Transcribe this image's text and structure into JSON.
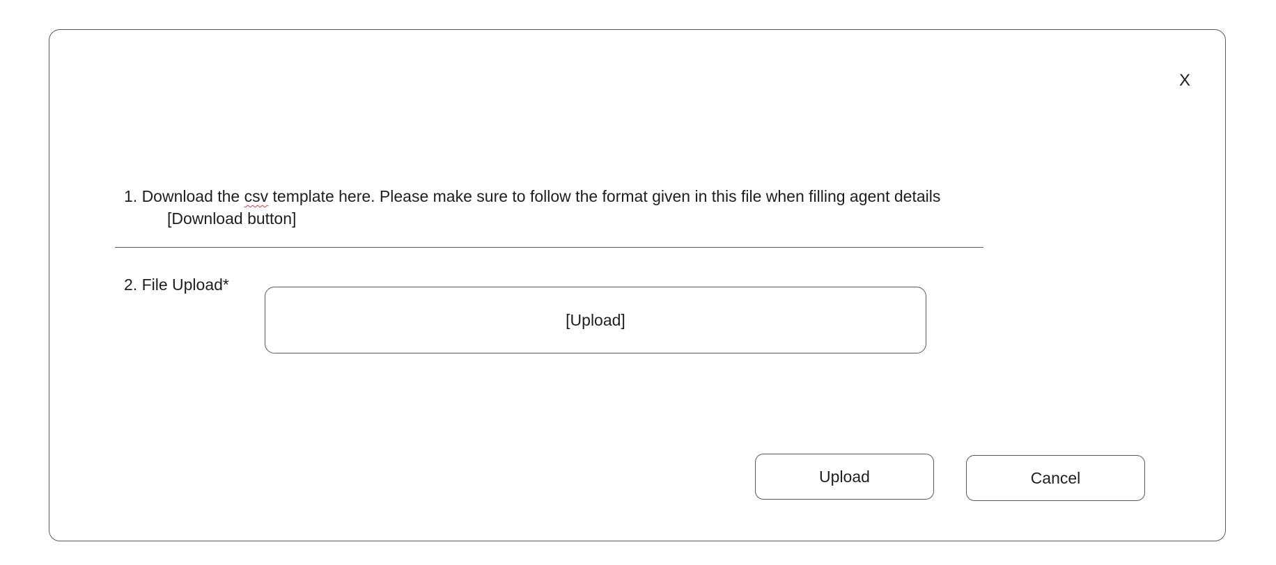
{
  "dialog": {
    "close_label": "X",
    "step1": {
      "prefix": "1. Download the ",
      "csv_word": "csv",
      "suffix": " template here. Please make sure to follow the format given in this file when filling agent details",
      "download_label": "[Download button]"
    },
    "step2": {
      "label": "2. File Upload*",
      "upload_zone_label": "[Upload]"
    },
    "buttons": {
      "upload_label": "Upload",
      "cancel_label": "Cancel"
    }
  }
}
